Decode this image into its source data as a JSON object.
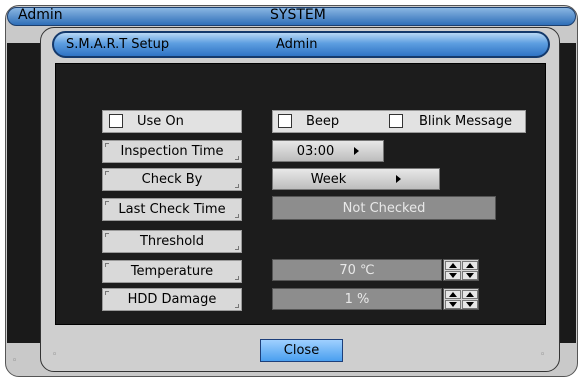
{
  "background_window": {
    "title_left": "Admin",
    "title_center": "SYSTEM"
  },
  "dialog": {
    "title_left": "S.M.A.R.T Setup",
    "title_center": "Admin"
  },
  "options": {
    "use_on": {
      "label": "Use On",
      "checked": false
    },
    "beep": {
      "label": "Beep",
      "checked": false
    },
    "blink_message": {
      "label": "Blink Message",
      "checked": false
    }
  },
  "fields": {
    "inspection_time": {
      "label": "Inspection Time",
      "value": "03:00"
    },
    "check_by": {
      "label": "Check By",
      "value": "Week"
    },
    "last_check_time": {
      "label": "Last Check Time",
      "value": "Not Checked"
    },
    "threshold": {
      "label": "Threshold"
    },
    "temperature": {
      "label": "Temperature",
      "value": "70 ℃"
    },
    "hdd_damage": {
      "label": "HDD Damage",
      "value": "1 %"
    }
  },
  "buttons": {
    "close": "Close"
  },
  "colors": {
    "title_bar_blue": "#2f73c4",
    "close_button_blue": "#4a9fef",
    "panel_black": "#1c1c1c"
  }
}
